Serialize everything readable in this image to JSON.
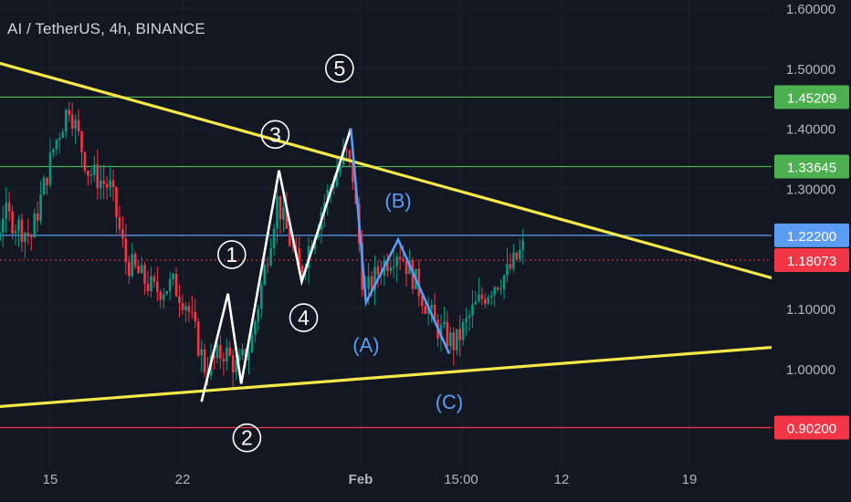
{
  "header": {
    "title": "AI / TetherUS, 4h, BINANCE"
  },
  "chart_data": {
    "type": "candlestick",
    "y_axis": {
      "ticks": [
        "1.60000",
        "1.50000",
        "1.40000",
        "1.30000",
        "1.10000",
        "1.00000"
      ],
      "ylim": [
        0.87,
        1.62
      ]
    },
    "x_axis": {
      "ticks": [
        "15",
        "22",
        "Feb",
        "15:00",
        "12",
        "19"
      ]
    },
    "price_levels": [
      {
        "value": 1.45209,
        "label": "1.45209",
        "color": "#4caf50",
        "style": "solid"
      },
      {
        "value": 1.33645,
        "label": "1.33645",
        "color": "#4caf50",
        "style": "solid"
      },
      {
        "value": 1.222,
        "label": "1.22200",
        "color": "#5b9cf6",
        "style": "solid"
      },
      {
        "value": 1.18073,
        "label": "1.18073",
        "color": "#f23645",
        "style": "dotted"
      },
      {
        "value": 0.902,
        "label": "0.90200",
        "color": "#f23645",
        "style": "solid"
      }
    ],
    "trendlines": [
      {
        "name": "upper",
        "color": "#f5e94a",
        "from": {
          "day": -1,
          "price": 1.625
        },
        "to": {
          "day": 24,
          "price": 1.135
        }
      },
      {
        "name": "lower",
        "color": "#f5e94a",
        "from": {
          "day": -1,
          "price": 0.905
        },
        "to": {
          "day": 24,
          "price": 1.04
        }
      }
    ],
    "impulse_wave": {
      "color": "#ffffff",
      "points": [
        {
          "day": 23.0,
          "price": 0.945
        },
        {
          "day": 24.4,
          "price": 1.125
        },
        {
          "day": 25.1,
          "price": 0.975
        },
        {
          "day": 27.1,
          "price": 1.33
        },
        {
          "day": 28.3,
          "price": 1.145
        },
        {
          "day": 30.9,
          "price": 1.4
        }
      ],
      "labels": [
        {
          "text": "1",
          "day": 24.6,
          "price": 1.19
        },
        {
          "text": "2",
          "day": 25.4,
          "price": 0.885
        },
        {
          "text": "3",
          "day": 26.9,
          "price": 1.39
        },
        {
          "text": "4",
          "day": 28.4,
          "price": 1.085
        },
        {
          "text": "5",
          "day": 30.3,
          "price": 1.5
        }
      ]
    },
    "corrective_wave": {
      "color": "#5b9cf6",
      "points": [
        {
          "day": 30.9,
          "price": 1.4
        },
        {
          "day": 31.7,
          "price": 1.11
        },
        {
          "day": 33.4,
          "price": 1.215
        },
        {
          "day": 36.1,
          "price": 1.025
        }
      ],
      "labels": [
        {
          "text": "(A)",
          "day": 31.7,
          "price": 1.04
        },
        {
          "text": "(B)",
          "day": 33.4,
          "price": 1.28
        },
        {
          "text": "(C)",
          "day": 36.1,
          "price": 0.945
        }
      ]
    },
    "last_price": 1.18073,
    "grid": true
  }
}
